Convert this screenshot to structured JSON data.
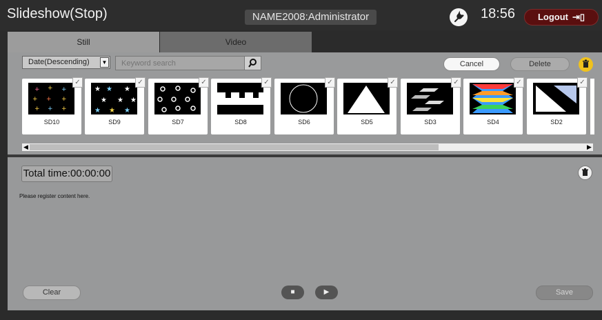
{
  "header": {
    "title": "Slideshow(Stop)",
    "user": "NAME2008:Administrator",
    "time": "18:56",
    "logout_label": "Logout"
  },
  "tabs": [
    {
      "label": "Still",
      "active": true
    },
    {
      "label": "Video",
      "active": false
    }
  ],
  "toolbar": {
    "sort_value": "Date(Descending)",
    "search_placeholder": "Keyword search",
    "cancel_label": "Cancel",
    "delete_label": "Delete"
  },
  "thumbnails": [
    {
      "label": "SD10",
      "checked": true
    },
    {
      "label": "SD9",
      "checked": true
    },
    {
      "label": "SD7",
      "checked": true
    },
    {
      "label": "SD8",
      "checked": true
    },
    {
      "label": "SD6",
      "checked": true
    },
    {
      "label": "SD5",
      "checked": true
    },
    {
      "label": "SD3",
      "checked": true
    },
    {
      "label": "SD4",
      "checked": true
    },
    {
      "label": "SD2",
      "checked": true
    }
  ],
  "playlist": {
    "total_time": "Total time:00:00:00",
    "hint": "Please register content here.",
    "clear_label": "Clear",
    "save_label": "Save"
  },
  "colors": {
    "logout_bg": "#5a0f0f",
    "accent_trash": "#f0c21d",
    "panel": "#999a9b"
  }
}
